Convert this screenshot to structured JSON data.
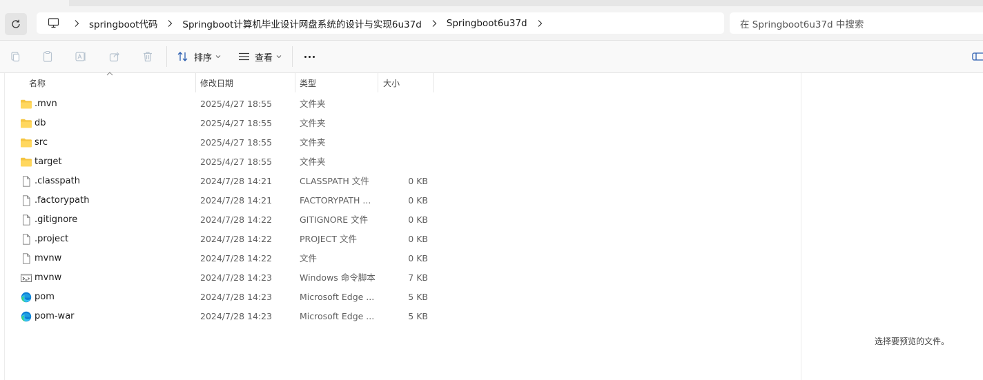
{
  "address": {
    "breadcrumbs": [
      "springboot代码",
      "Springboot计算机毕业设计网盘系统的设计与实现6u37d",
      "Springboot6u37d"
    ]
  },
  "search": {
    "placeholder": "在 Springboot6u37d 中搜索"
  },
  "toolbar": {
    "sort_label": "排序",
    "view_label": "查看"
  },
  "columns": {
    "name": "名称",
    "modified": "修改日期",
    "type": "类型",
    "size": "大小"
  },
  "files": [
    {
      "name": ".mvn",
      "date": "2025/4/27 18:55",
      "type": "文件夹",
      "size": "",
      "icon": "folder-icon"
    },
    {
      "name": "db",
      "date": "2025/4/27 18:55",
      "type": "文件夹",
      "size": "",
      "icon": "folder-icon"
    },
    {
      "name": "src",
      "date": "2025/4/27 18:55",
      "type": "文件夹",
      "size": "",
      "icon": "folder-icon"
    },
    {
      "name": "target",
      "date": "2025/4/27 18:55",
      "type": "文件夹",
      "size": "",
      "icon": "folder-icon"
    },
    {
      "name": ".classpath",
      "date": "2024/7/28 14:21",
      "type": "CLASSPATH 文件",
      "size": "0 KB",
      "icon": "file-icon"
    },
    {
      "name": ".factorypath",
      "date": "2024/7/28 14:21",
      "type": "FACTORYPATH ...",
      "size": "0 KB",
      "icon": "file-icon"
    },
    {
      "name": ".gitignore",
      "date": "2024/7/28 14:22",
      "type": "GITIGNORE 文件",
      "size": "0 KB",
      "icon": "file-icon"
    },
    {
      "name": ".project",
      "date": "2024/7/28 14:22",
      "type": "PROJECT 文件",
      "size": "0 KB",
      "icon": "file-icon"
    },
    {
      "name": "mvnw",
      "date": "2024/7/28 14:22",
      "type": "文件",
      "size": "0 KB",
      "icon": "file-icon"
    },
    {
      "name": "mvnw",
      "date": "2024/7/28 14:23",
      "type": "Windows 命令脚本",
      "size": "7 KB",
      "icon": "cmd-script-icon"
    },
    {
      "name": "pom",
      "date": "2024/7/28 14:23",
      "type": "Microsoft Edge ...",
      "size": "5 KB",
      "icon": "edge-icon"
    },
    {
      "name": "pom-war",
      "date": "2024/7/28 14:23",
      "type": "Microsoft Edge ...",
      "size": "5 KB",
      "icon": "edge-icon"
    }
  ],
  "preview": {
    "message": "选择要预览的文件。"
  }
}
